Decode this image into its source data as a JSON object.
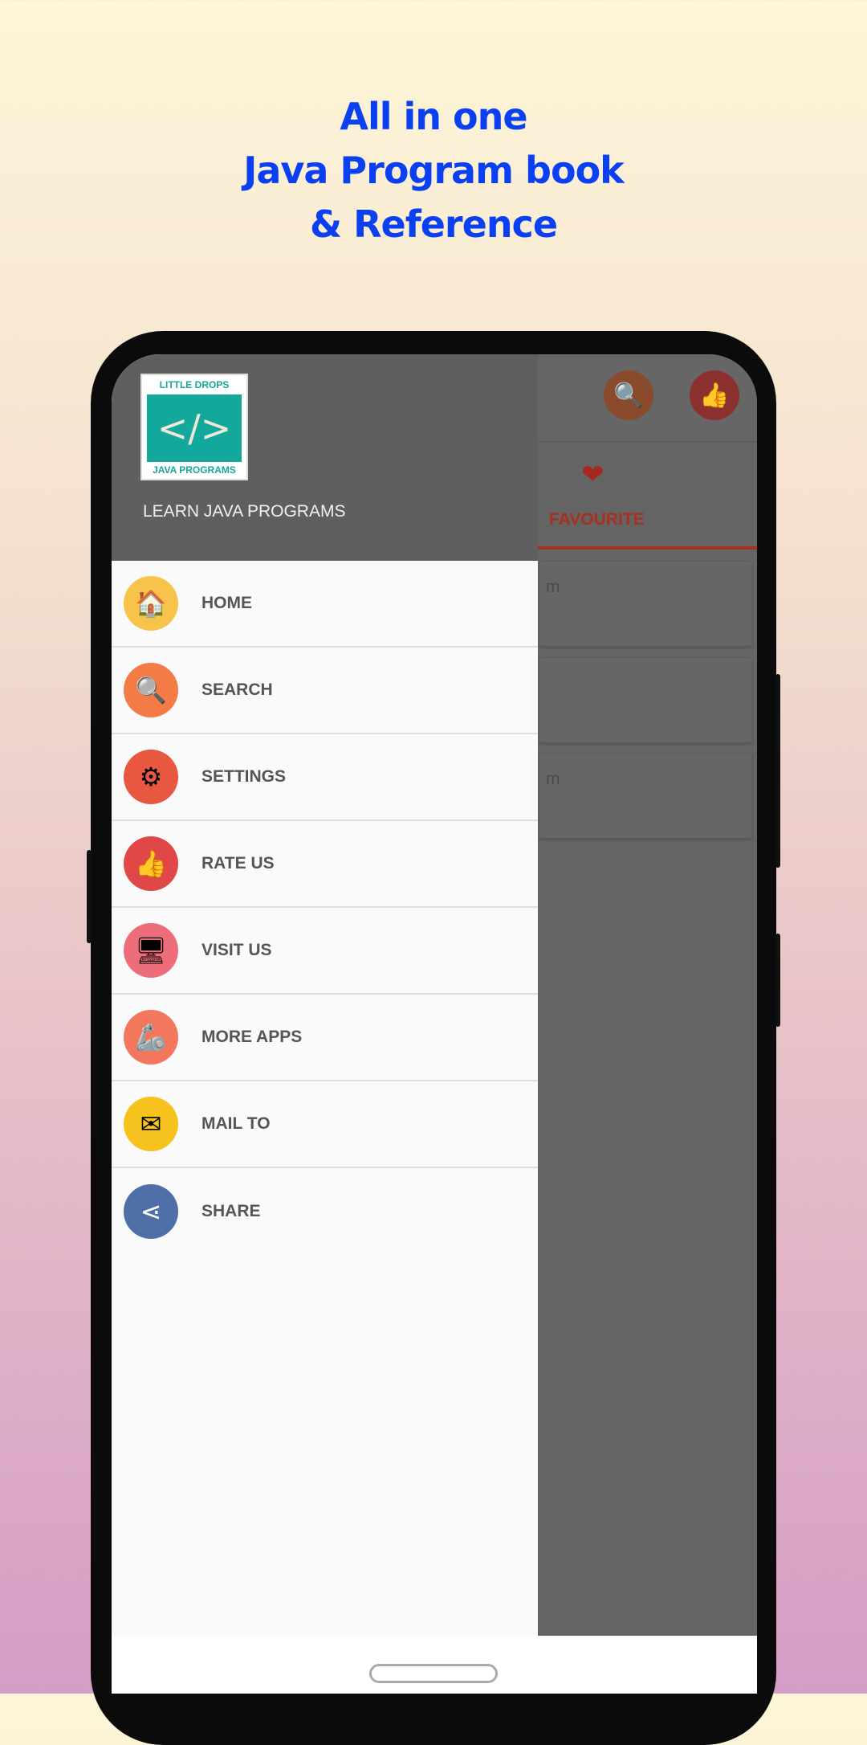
{
  "headline": {
    "line1": "All in one",
    "line2": "Java Program book",
    "line3": "& Reference"
  },
  "colors": {
    "headline": "#0a3ff2",
    "accent": "#a8301f",
    "drawer_header": "#5f5f5f"
  },
  "toolbar": {
    "icons": [
      "search-icon",
      "thumbs-up-icon"
    ]
  },
  "tabs": {
    "active_label": "FAVOURITE",
    "active_icon": "heart-icon"
  },
  "cards": [
    {
      "text_fragment": "m"
    },
    {
      "text_fragment": ""
    },
    {
      "text_fragment": "m"
    }
  ],
  "drawer": {
    "logo": {
      "top": "LITTLE DROPS",
      "bottom": "JAVA PROGRAMS",
      "symbol": "</>"
    },
    "title": "LEARN JAVA PROGRAMS",
    "items": [
      {
        "label": "HOME",
        "icon": "home-icon",
        "color": "#f8c34a"
      },
      {
        "label": "SEARCH",
        "icon": "search-icon",
        "color": "#f47b46"
      },
      {
        "label": "SETTINGS",
        "icon": "settings-icon",
        "color": "#e8573f"
      },
      {
        "label": "RATE US",
        "icon": "thumbs-up-icon",
        "color": "#e04848"
      },
      {
        "label": "VISIT US",
        "icon": "monitor-icon",
        "color": "#ee6d7a"
      },
      {
        "label": "MORE APPS",
        "icon": "robot-arm-icon",
        "color": "#f2775d"
      },
      {
        "label": "MAIL TO",
        "icon": "mail-icon",
        "color": "#f6c21d"
      },
      {
        "label": "SHARE",
        "icon": "share-icon",
        "color": "#4f6fa8"
      }
    ]
  }
}
